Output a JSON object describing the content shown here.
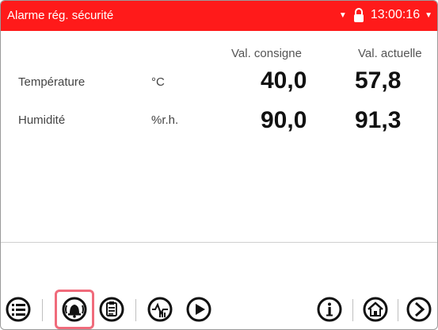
{
  "header": {
    "title": "Alarme rég. sécurité",
    "time": "13:00:16",
    "colors": {
      "bar": "#ff1a1a",
      "text": "#ffffff"
    }
  },
  "columns": {
    "setpoint": "Val. consigne",
    "actual": "Val. actuelle"
  },
  "rows": [
    {
      "label": "Température",
      "unit": "°C",
      "setpoint": "40,0",
      "actual": "57,8"
    },
    {
      "label": "Humidité",
      "unit": "%r.h.",
      "setpoint": "90,0",
      "actual": "91,3"
    }
  ],
  "toolbar": {
    "icons": [
      "menu-icon",
      "alarm-bell-icon",
      "clipboard-icon",
      "touch-program-icon",
      "play-icon",
      "info-icon",
      "home-icon",
      "next-arrow-icon"
    ]
  }
}
